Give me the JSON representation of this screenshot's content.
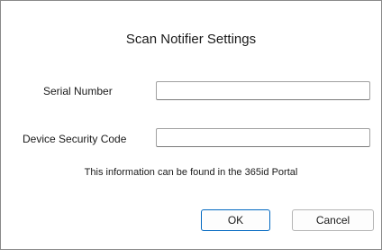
{
  "dialog": {
    "title": "Scan Notifier Settings"
  },
  "form": {
    "serial_label": "Serial Number",
    "serial_value": "",
    "code_label": "Device Security Code",
    "code_value": ""
  },
  "info_text": "This information can be found in the 365id Portal",
  "buttons": {
    "ok_label": "OK",
    "cancel_label": "Cancel"
  },
  "colors": {
    "default_button_border": "#0067c0",
    "dialog_border": "#8a8a8a"
  }
}
